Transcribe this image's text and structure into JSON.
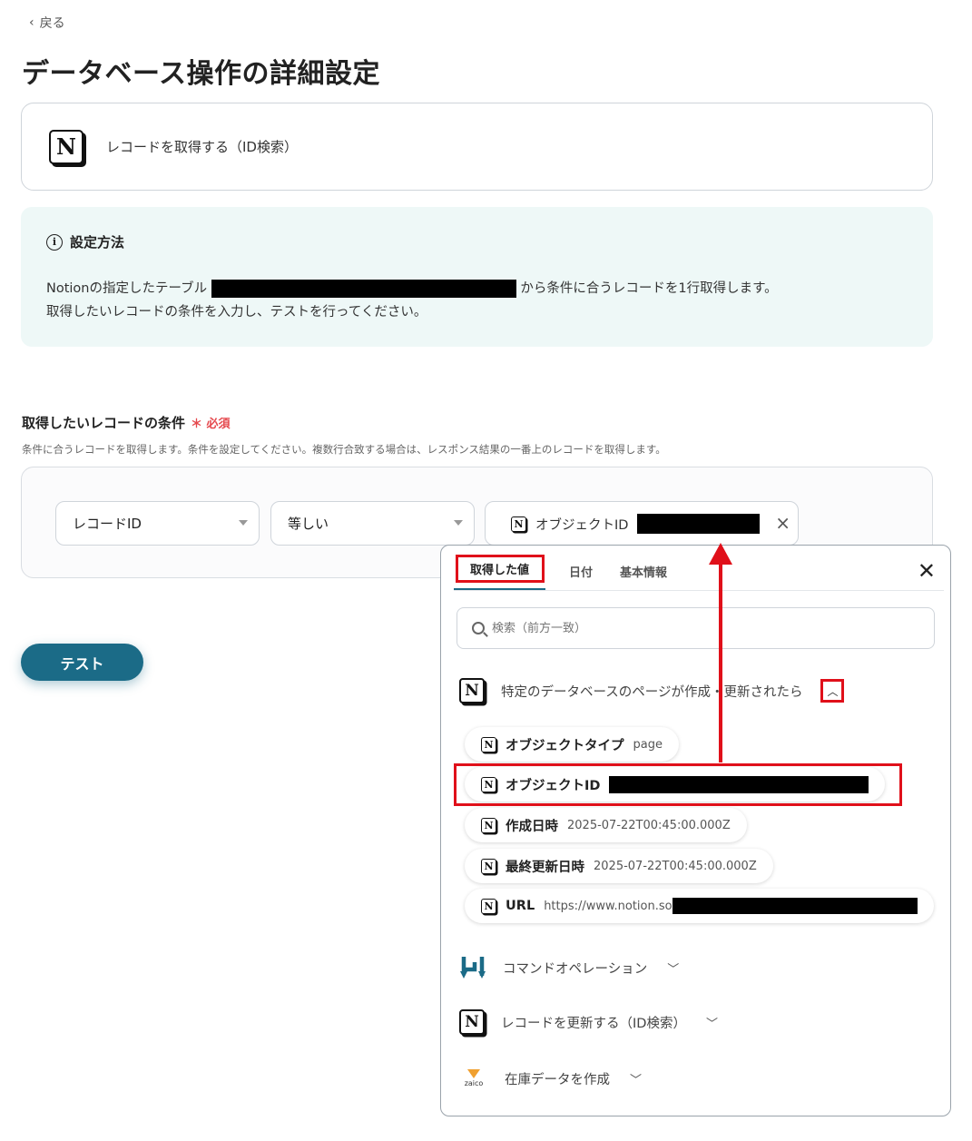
{
  "nav": {
    "back_label": "戻る"
  },
  "page": {
    "title": "データベース操作の詳細設定"
  },
  "action": {
    "label": "レコードを取得する（ID検索）"
  },
  "info": {
    "title": "設定方法",
    "line1_prefix": "Notionの指定したテーブル",
    "line1_suffix": "から条件に合うレコードを1行取得します。",
    "line2": "取得したいレコードの条件を入力し、テストを行ってください。"
  },
  "condition": {
    "label": "取得したいレコードの条件",
    "required_label": "必須",
    "description": "条件に合うレコードを取得します。条件を設定してください。複数行合致する場合は、レスポンス結果の一番上のレコードを取得します。",
    "field_select": "レコードID",
    "operator_select": "等しい",
    "value_chip_label": "オブジェクトID"
  },
  "test_button": "テスト",
  "panel": {
    "tabs": [
      "取得した値",
      "日付",
      "基本情報"
    ],
    "active_tab": "取得した値",
    "search_placeholder": "検索（前方一致）",
    "trigger_group": "特定のデータベースのページが作成・更新されたら",
    "items": [
      {
        "name": "オブジェクトタイプ",
        "value": "page"
      },
      {
        "name": "オブジェクトID",
        "value": ""
      },
      {
        "name": "作成日時",
        "value": "2025-07-22T00:45:00.000Z"
      },
      {
        "name": "最終更新日時",
        "value": "2025-07-22T00:45:00.000Z"
      },
      {
        "name": "URL",
        "value": "https://www.notion.so"
      }
    ],
    "groups": [
      {
        "label": "コマンドオペレーション",
        "icon": "yoom-command-icon"
      },
      {
        "label": "レコードを更新する（ID検索）",
        "icon": "notion-icon"
      },
      {
        "label": "在庫データを作成",
        "icon": "zaico-icon"
      }
    ],
    "zaico_text": "zaico"
  },
  "colors": {
    "accent": "#1b6b87",
    "highlight": "#e0101a",
    "info_bg": "#eef8f7",
    "required": "#e5484d"
  }
}
